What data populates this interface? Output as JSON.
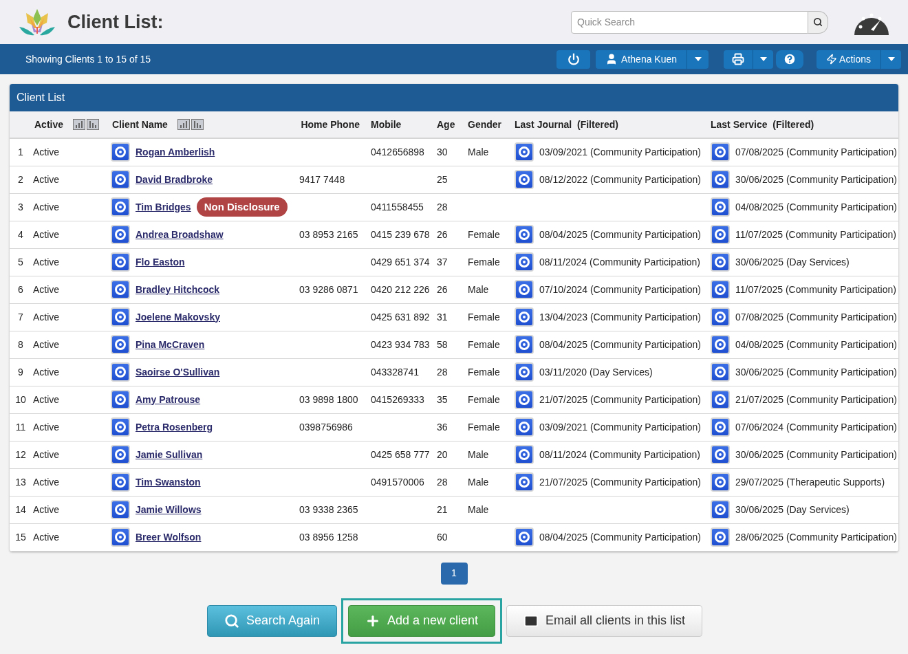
{
  "header": {
    "title": "Client List:",
    "search": {
      "placeholder": "Quick Search"
    }
  },
  "toolbar": {
    "status": "Showing Clients 1 to 15 of 15",
    "user": "Athena Kuen",
    "actions": "Actions"
  },
  "panel": {
    "title": "Client List"
  },
  "table": {
    "columns": [
      {
        "label": "Active",
        "sortable": true
      },
      {
        "label": "Client Name",
        "sortable": true
      },
      {
        "label": "Home Phone",
        "sortable": false
      },
      {
        "label": "Mobile",
        "sortable": false
      },
      {
        "label": "Age",
        "sortable": false
      },
      {
        "label": "Gender",
        "sortable": false
      },
      {
        "label": "Last Journal  (Filtered)",
        "sortable": false
      },
      {
        "label": "Last Service  (Filtered)",
        "sortable": false
      }
    ],
    "rows": [
      {
        "number": "1",
        "status": "Active",
        "name": "Rogan Amberlish",
        "home": "",
        "mobile": "0412656898",
        "age": "30",
        "gender": "Male",
        "journal": "03/09/2021 (Community Participation)",
        "service": "07/08/2025 (Community Participation)"
      },
      {
        "number": "2",
        "status": "Active",
        "name": "David Bradbroke",
        "home": "9417 7448",
        "mobile": "",
        "age": "25",
        "gender": "",
        "journal": "08/12/2022 (Community Participation)",
        "service": "30/06/2025 (Community Participation)"
      },
      {
        "number": "3",
        "status": "Active",
        "name": "Tim Bridges",
        "badge": "Non Disclosure",
        "home": "",
        "mobile": "0411558455",
        "age": "28",
        "gender": "",
        "journal": "",
        "service": "04/08/2025 (Community Participation)"
      },
      {
        "number": "4",
        "status": "Active",
        "name": "Andrea Broadshaw",
        "home": "03 8953 2165",
        "mobile": "0415 239 678",
        "age": "26",
        "gender": "Female",
        "journal": "08/04/2025 (Community Participation)",
        "service": "11/07/2025 (Community Participation)"
      },
      {
        "number": "5",
        "status": "Active",
        "name": "Flo Easton",
        "home": "",
        "mobile": "0429 651 374",
        "age": "37",
        "gender": "Female",
        "journal": "08/11/2024 (Community Participation)",
        "service": "30/06/2025 (Day Services)"
      },
      {
        "number": "6",
        "status": "Active",
        "name": "Bradley Hitchcock",
        "home": "03 9286 0871",
        "mobile": "0420 212 226",
        "age": "26",
        "gender": "Male",
        "journal": "07/10/2024 (Community Participation)",
        "service": "11/07/2025 (Community Participation)"
      },
      {
        "number": "7",
        "status": "Active",
        "name": "Joelene Makovsky",
        "home": "",
        "mobile": "0425 631 892",
        "age": "31",
        "gender": "Female",
        "journal": "13/04/2023 (Community Participation)",
        "service": "07/08/2025 (Community Participation)"
      },
      {
        "number": "8",
        "status": "Active",
        "name": "Pina McCraven",
        "home": "",
        "mobile": "0423 934 783",
        "age": "58",
        "gender": "Female",
        "journal": "08/04/2025 (Community Participation)",
        "service": "04/08/2025 (Community Participation)"
      },
      {
        "number": "9",
        "status": "Active",
        "name": "Saoirse O'Sullivan",
        "home": "",
        "mobile": "043328741",
        "age": "28",
        "gender": "Female",
        "journal": "03/11/2020 (Day Services)",
        "service": "30/06/2025 (Community Participation)"
      },
      {
        "number": "10",
        "status": "Active",
        "name": "Amy Patrouse",
        "home": "03 9898 1800",
        "mobile": "0415269333",
        "age": "35",
        "gender": "Female",
        "journal": "21/07/2025 (Community Participation)",
        "service": "21/07/2025 (Community Participation)"
      },
      {
        "number": "11",
        "status": "Active",
        "name": "Petra Rosenberg",
        "home": "0398756986",
        "mobile": "",
        "age": "36",
        "gender": "Female",
        "journal": "03/09/2021 (Community Participation)",
        "service": "07/06/2024 (Community Participation)"
      },
      {
        "number": "12",
        "status": "Active",
        "name": "Jamie Sullivan",
        "home": "",
        "mobile": "0425 658 777",
        "age": "20",
        "gender": "Male",
        "journal": "08/11/2024 (Community Participation)",
        "service": "30/06/2025 (Community Participation)"
      },
      {
        "number": "13",
        "status": "Active",
        "name": "Tim Swanston",
        "home": "",
        "mobile": "0491570006",
        "age": "28",
        "gender": "Male",
        "journal": "21/07/2025 (Community Participation)",
        "service": "29/07/2025 (Therapeutic Supports)"
      },
      {
        "number": "14",
        "status": "Active",
        "name": "Jamie Willows",
        "home": "03 9338 2365",
        "mobile": "",
        "age": "21",
        "gender": "Male",
        "journal": "",
        "service": "30/06/2025 (Day Services)"
      },
      {
        "number": "15",
        "status": "Active",
        "name": "Breer Wolfson",
        "home": "03 8956 1258",
        "mobile": "",
        "age": "60",
        "gender": "",
        "journal": "08/04/2025 (Community Participation)",
        "service": "28/06/2025 (Community Participation)"
      }
    ]
  },
  "pagination": [
    {
      "label": "1",
      "selected": true
    }
  ],
  "buttons": [
    {
      "kind": "search",
      "label": "Search Again",
      "focused": false
    },
    {
      "kind": "add",
      "label": "Add a new client",
      "focused": true
    },
    {
      "kind": "email",
      "label": "Email all clients in this list",
      "focused": false
    }
  ]
}
